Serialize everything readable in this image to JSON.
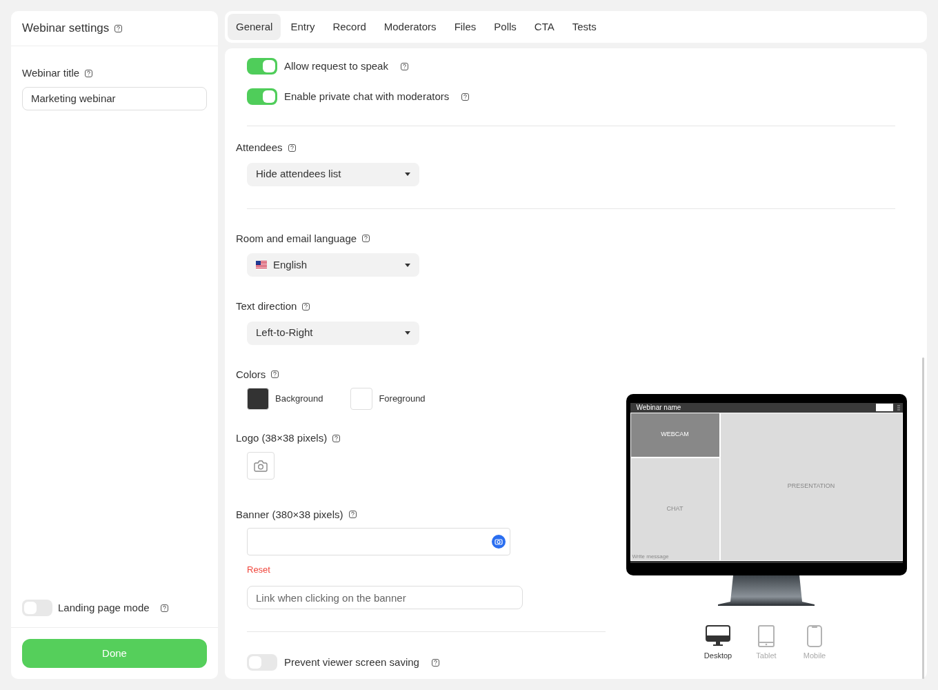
{
  "sidebar": {
    "title": "Webinar settings",
    "webinar_title": {
      "label": "Webinar title",
      "value": "Marketing webinar"
    },
    "landing_mode": {
      "label": "Landing page mode",
      "on": false
    },
    "done_button": "Done"
  },
  "tabs": [
    {
      "label": "General",
      "selected": true
    },
    {
      "label": "Entry",
      "selected": false
    },
    {
      "label": "Record",
      "selected": false
    },
    {
      "label": "Moderators",
      "selected": false
    },
    {
      "label": "Files",
      "selected": false
    },
    {
      "label": "Polls",
      "selected": false
    },
    {
      "label": "CTA",
      "selected": false
    },
    {
      "label": "Tests",
      "selected": false
    }
  ],
  "toggles": [
    {
      "label": "Allow request to speak",
      "on": true
    },
    {
      "label": "Enable private chat with moderators",
      "on": true
    }
  ],
  "attendees": {
    "label": "Attendees",
    "value": "Hide attendees list"
  },
  "language": {
    "label": "Room and email language",
    "value": "English"
  },
  "text_direction": {
    "label": "Text direction",
    "value": "Left-to-Right"
  },
  "colors": {
    "label": "Colors",
    "items": [
      {
        "label": "Background",
        "color": "#333333"
      },
      {
        "label": "Foreground",
        "color": "#ffffff"
      }
    ]
  },
  "logo": {
    "label": "Logo (38×38 pixels)"
  },
  "banner": {
    "label": "Banner (380×38 pixels)",
    "reset": "Reset",
    "link_placeholder": "Link when clicking on the banner"
  },
  "prevent_saving": {
    "label": "Prevent viewer screen saving",
    "on": false
  },
  "preview": {
    "title": "Webinar name",
    "webcam": "WEBCAM",
    "chat": "CHAT",
    "presentation": "PRESENTATION",
    "message_placeholder": "Write message",
    "devices": [
      {
        "label": "Desktop",
        "kind": "desktop",
        "selected": true
      },
      {
        "label": "Tablet",
        "kind": "tablet",
        "selected": false
      },
      {
        "label": "Mobile",
        "kind": "mobile",
        "selected": false
      }
    ]
  }
}
